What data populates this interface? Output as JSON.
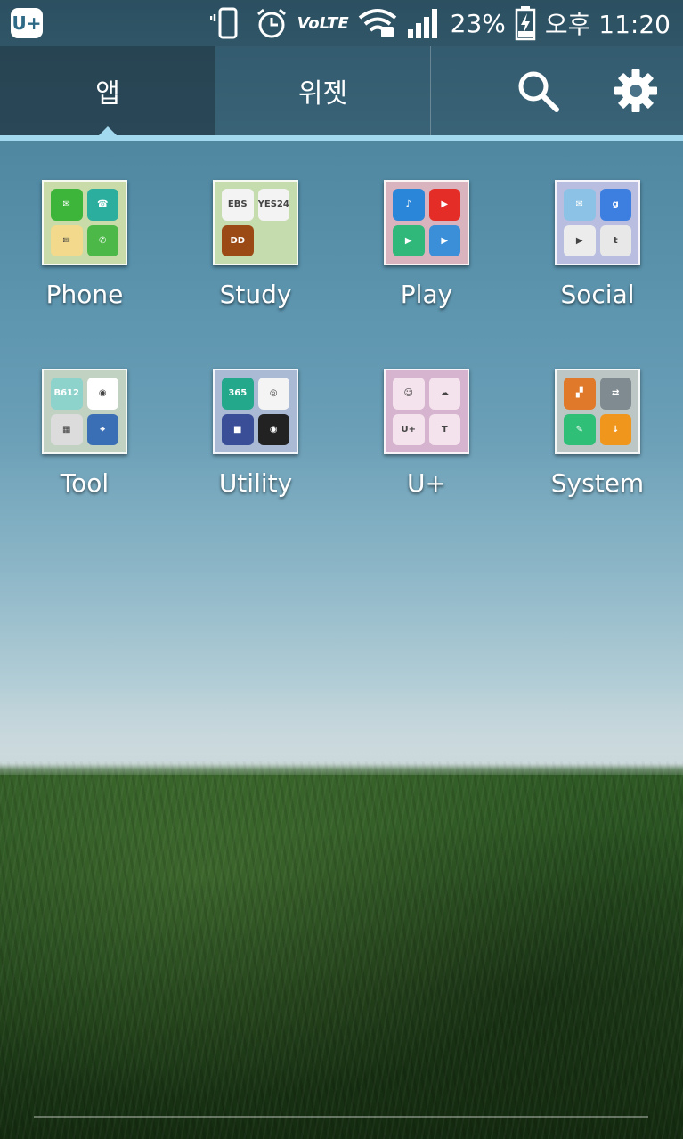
{
  "status_bar": {
    "carrier_logo": "U+",
    "network": "VoLTE",
    "battery": "23%",
    "time": "오후 11:20",
    "icons": [
      "vibrate-icon",
      "alarm-icon",
      "volte-icon",
      "wifi-lock-icon",
      "signal-icon",
      "battery-charging-icon"
    ]
  },
  "tabs": [
    {
      "label": "앱",
      "active": true
    },
    {
      "label": "위젯",
      "active": false
    }
  ],
  "toolbar": {
    "search_icon": "search-icon",
    "settings_icon": "gear-icon"
  },
  "folders": [
    {
      "label": "Phone",
      "color": "#c8dba8",
      "apps": [
        {
          "icon": "message-icon",
          "color": "#3cb53a",
          "glyph": "✉"
        },
        {
          "icon": "contacts-icon",
          "color": "#2cae9e",
          "glyph": "☎"
        },
        {
          "icon": "email-icon",
          "color": "#f2d98b",
          "glyph": "✉"
        },
        {
          "icon": "phone-icon",
          "color": "#4cb848",
          "glyph": "✆"
        }
      ]
    },
    {
      "label": "Study",
      "color": "#c5dcae",
      "apps": [
        {
          "icon": "ebs-icon",
          "color": "#f3f3f3",
          "glyph": "EBS"
        },
        {
          "icon": "yes24-icon",
          "color": "#f3f3f3",
          "glyph": "YES24"
        },
        {
          "icon": "diodict-icon",
          "color": "#9b4a16",
          "glyph": "DD"
        },
        {
          "icon": "empty-slot",
          "color": "transparent",
          "glyph": ""
        }
      ]
    },
    {
      "label": "Play",
      "color": "#d9b3bd",
      "apps": [
        {
          "icon": "music-icon",
          "color": "#2a86d8",
          "glyph": "♪"
        },
        {
          "icon": "youtube-icon",
          "color": "#e52d27",
          "glyph": "▶"
        },
        {
          "icon": "play-movies-icon",
          "color": "#2fb87a",
          "glyph": "▶"
        },
        {
          "icon": "video-icon",
          "color": "#3a8fd8",
          "glyph": "▶"
        }
      ]
    },
    {
      "label": "Social",
      "color": "#b9bee0",
      "apps": [
        {
          "icon": "kakao-icon",
          "color": "#8cc2e5",
          "glyph": "✉"
        },
        {
          "icon": "google-icon",
          "color": "#3d7fe0",
          "glyph": "g"
        },
        {
          "icon": "play-store-icon",
          "color": "#ececec",
          "glyph": "▶"
        },
        {
          "icon": "tumblr-icon",
          "color": "#e8e8e8",
          "glyph": "t"
        }
      ]
    },
    {
      "label": "Tool",
      "color": "#c2d2c2",
      "apps": [
        {
          "icon": "b612-icon",
          "color": "#8ed2cc",
          "glyph": "B612"
        },
        {
          "icon": "color-wheel-icon",
          "color": "#ffffff",
          "glyph": "◉"
        },
        {
          "icon": "calculator-icon",
          "color": "#dcdcdc",
          "glyph": "▦"
        },
        {
          "icon": "map-pin-icon",
          "color": "#3b6fb5",
          "glyph": "⌖"
        }
      ]
    },
    {
      "label": "Utility",
      "color": "#aab9d4",
      "apps": [
        {
          "icon": "365-icon",
          "color": "#23a88b",
          "glyph": "365"
        },
        {
          "icon": "camera-circle-icon",
          "color": "#f4f4f4",
          "glyph": "◎"
        },
        {
          "icon": "video-call-icon",
          "color": "#3a4e98",
          "glyph": "■"
        },
        {
          "icon": "camera-icon",
          "color": "#222222",
          "glyph": "◉"
        }
      ]
    },
    {
      "label": "U+",
      "color": "#d6b4cf",
      "apps": [
        {
          "icon": "customer-service-icon",
          "color": "#f4e3ec",
          "glyph": "☺"
        },
        {
          "icon": "cloud-icon",
          "color": "#f4e3ec",
          "glyph": "☁"
        },
        {
          "icon": "uplus-20-icon",
          "color": "#f4e3ec",
          "glyph": "U+"
        },
        {
          "icon": "tmoney-icon",
          "color": "#f4e3ec",
          "glyph": "T"
        }
      ]
    },
    {
      "label": "System",
      "color": "#bcc6c4",
      "apps": [
        {
          "icon": "avg-icon",
          "color": "#e07a2a",
          "glyph": "▞"
        },
        {
          "icon": "storage-icon",
          "color": "#7f8a91",
          "glyph": "⇄"
        },
        {
          "icon": "cleaner-icon",
          "color": "#2fbf77",
          "glyph": "✎"
        },
        {
          "icon": "download-icon",
          "color": "#f0961d",
          "glyph": "↓"
        }
      ]
    }
  ]
}
